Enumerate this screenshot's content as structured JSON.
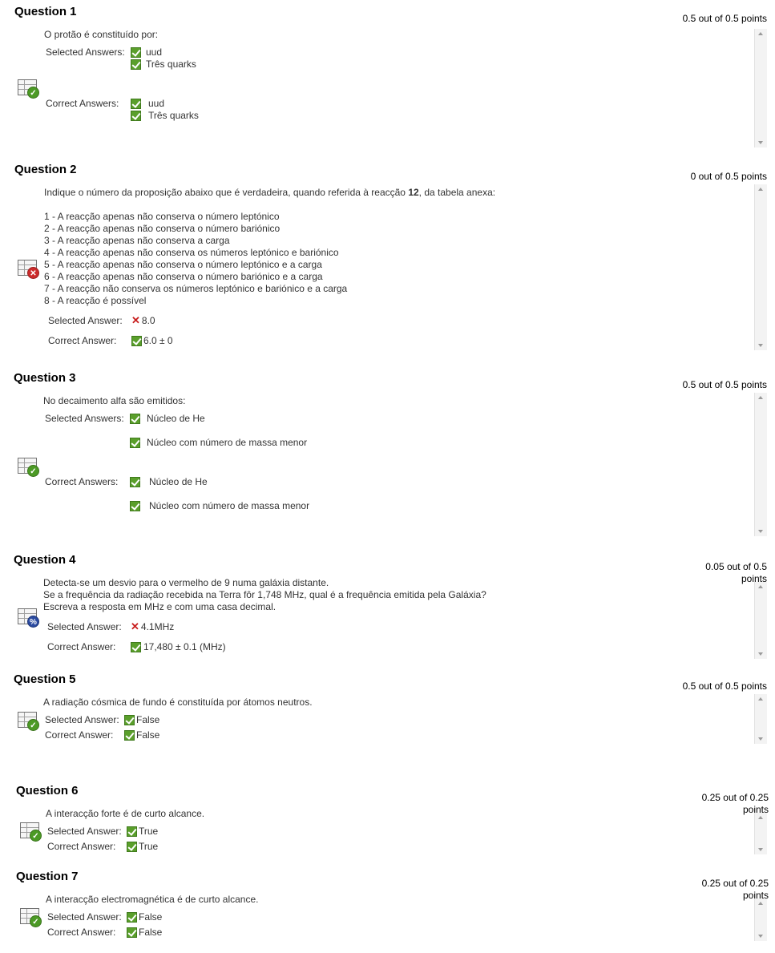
{
  "colors": {
    "correct": "#5a9f2b",
    "incorrect": "#c81e1e",
    "partial": "#2a4aa0"
  },
  "questions": [
    {
      "title": "Question 1",
      "points": "0.5 out of 0.5 points",
      "status_icon": "correct-grade-icon",
      "prompt": "O protão é constituído por:",
      "selected_label": "Selected Answers:",
      "selected": [
        "uud",
        "Três quarks"
      ],
      "correct_label": "Correct Answers:",
      "correct": [
        "uud",
        "Três quarks"
      ]
    },
    {
      "title": "Question 2",
      "points": "0 out of 0.5 points",
      "status_icon": "incorrect-grade-icon",
      "prompt_pre": "Indique o número da proposição abaixo que é verdadeira, quando referida à reacção ",
      "prompt_bold": "12",
      "prompt_post": ", da tabela anexa:",
      "options": [
        "1 - A reacção apenas não conserva o número leptónico",
        "2 - A reacção apenas não conserva o número bariónico",
        "3 - A reacção apenas não conserva a carga",
        "4 - A reacção apenas não conserva os números leptónico e bariónico",
        "5 - A reacção apenas não conserva o número leptónico e a carga",
        "6 - A reacção apenas não conserva o número bariónico e a carga",
        "7 - A reacção não conserva os números leptónico e bariónico e a carga",
        "8 - A reacção é possível"
      ],
      "selected_label": "Selected Answer:",
      "selected": "8.0",
      "correct_label": "Correct Answer:",
      "correct": "6.0 ± 0"
    },
    {
      "title": "Question 3",
      "points": "0.5 out of 0.5 points",
      "status_icon": "correct-grade-icon",
      "prompt": "No decaimento alfa são emitidos:",
      "selected_label": "Selected Answers:",
      "selected": [
        "Núcleo de He",
        "Núcleo com número de massa menor"
      ],
      "correct_label": "Correct Answers:",
      "correct": [
        "Núcleo de He",
        "Núcleo com número de massa menor"
      ]
    },
    {
      "title": "Question 4",
      "points_line1": "0.05 out of 0.5",
      "points_line2": "points",
      "status_icon": "partial-grade-icon",
      "prompt_lines": [
        "Detecta-se um desvio para o vermelho de 9 numa galáxia distante.",
        "Se a frequência da radiação recebida na Terra fôr 1,748 MHz, qual é a frequência emitida pela Galáxia?",
        "Escreva a resposta em MHz e com uma casa decimal."
      ],
      "selected_label": "Selected Answer:",
      "selected": "4.1MHz",
      "correct_label": "Correct Answer:",
      "correct": "17,480 ± 0.1 (MHz)"
    },
    {
      "title": "Question 5",
      "points": "0.5 out of 0.5 points",
      "status_icon": "correct-grade-icon",
      "prompt": "A radiação cósmica de fundo é constituída por átomos neutros.",
      "selected_label": "Selected Answer:",
      "selected": "False",
      "correct_label": "Correct Answer:",
      "correct": "False"
    },
    {
      "title": "Question 6",
      "points_line1": "0.25 out of 0.25",
      "points_line2": "points",
      "status_icon": "correct-grade-icon",
      "prompt": "A interacção forte é de curto alcance.",
      "selected_label": "Selected Answer:",
      "selected": "True",
      "correct_label": "Correct Answer:",
      "correct": "True"
    },
    {
      "title": "Question 7",
      "points_line1": "0.25 out of 0.25",
      "points_line2": "points",
      "status_icon": "correct-grade-icon",
      "prompt": "A interacção electromagnética é de curto alcance.",
      "selected_label": "Selected Answer:",
      "selected": "False",
      "correct_label": "Correct Answer:",
      "correct": "False"
    }
  ]
}
